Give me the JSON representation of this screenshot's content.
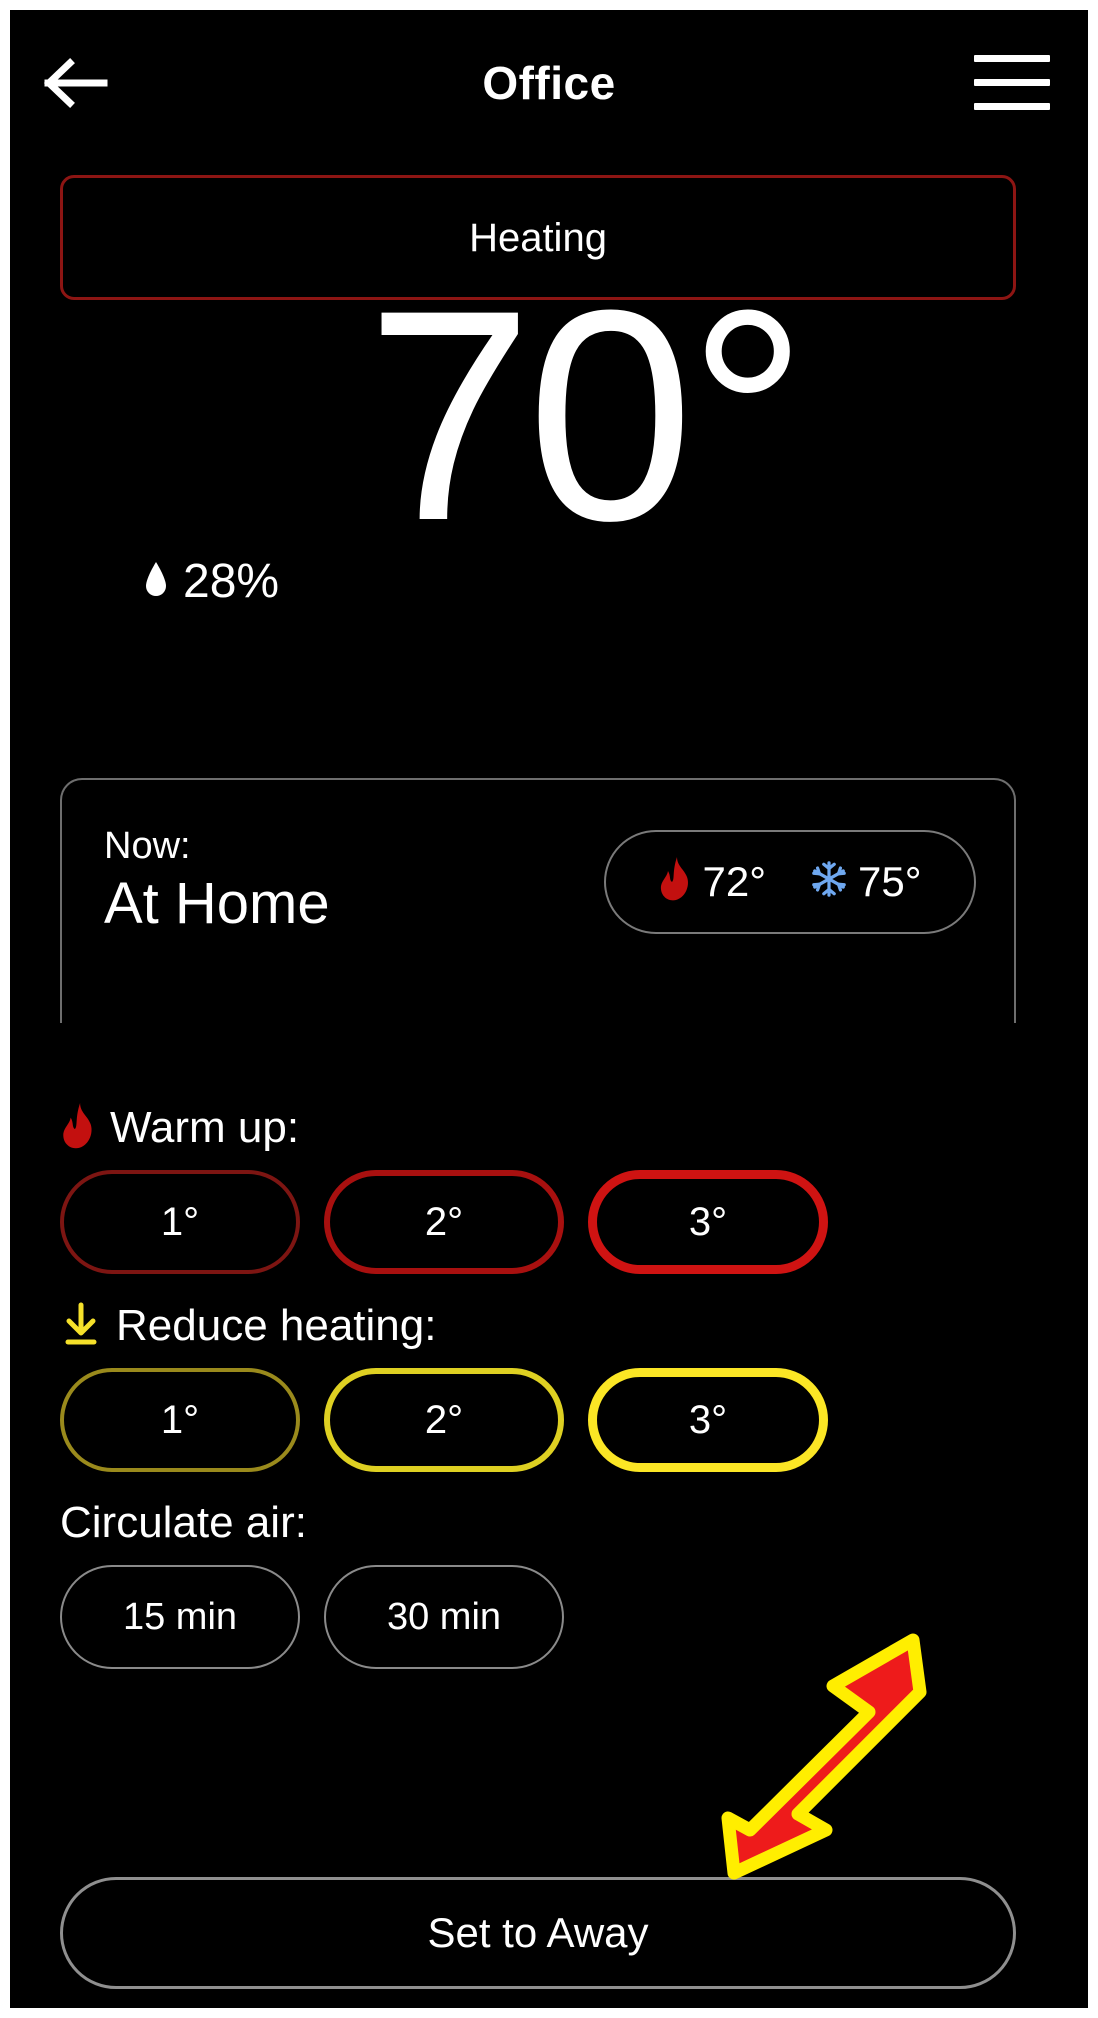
{
  "header": {
    "back_icon": "arrow-left-icon",
    "title": "Office",
    "menu_icon": "hamburger-menu-icon"
  },
  "mode": {
    "label": "Heating",
    "accent_color": "#8d1513"
  },
  "reading": {
    "temperature": "70°",
    "humidity_icon": "water-drop-icon",
    "humidity": "28%"
  },
  "now_card": {
    "label": "Now:",
    "value": "At Home",
    "setpoints": [
      {
        "icon": "flame-icon",
        "value": "72°",
        "color": "#c3100f"
      },
      {
        "icon": "snowflake-icon",
        "value": "75°",
        "color": "#6fa8f0"
      }
    ]
  },
  "sections": [
    {
      "id": "warm-up",
      "icon": "flame-icon",
      "title": "Warm up:",
      "accent_color": "#cf1312",
      "options": [
        {
          "label": "1°",
          "level": 1
        },
        {
          "label": "2°",
          "level": 2
        },
        {
          "label": "3°",
          "level": 3
        }
      ]
    },
    {
      "id": "reduce-heating",
      "icon": "arrow-down-to-line-icon",
      "title": "Reduce heating:",
      "accent_color": "#fbe625",
      "options": [
        {
          "label": "1°",
          "level": 1
        },
        {
          "label": "2°",
          "level": 2
        },
        {
          "label": "3°",
          "level": 3
        }
      ]
    },
    {
      "id": "circulate-air",
      "icon": null,
      "title": "Circulate air:",
      "accent_color": "#8a8a8a",
      "options": [
        {
          "label": "15 min"
        },
        {
          "label": "30 min"
        }
      ]
    }
  ],
  "away": {
    "label": "Set to Away"
  },
  "annotation": {
    "type": "pointer-arrow",
    "fill_color": "#ee1b1b",
    "outline_color": "#ffee00",
    "points_to": "Set to Away"
  }
}
